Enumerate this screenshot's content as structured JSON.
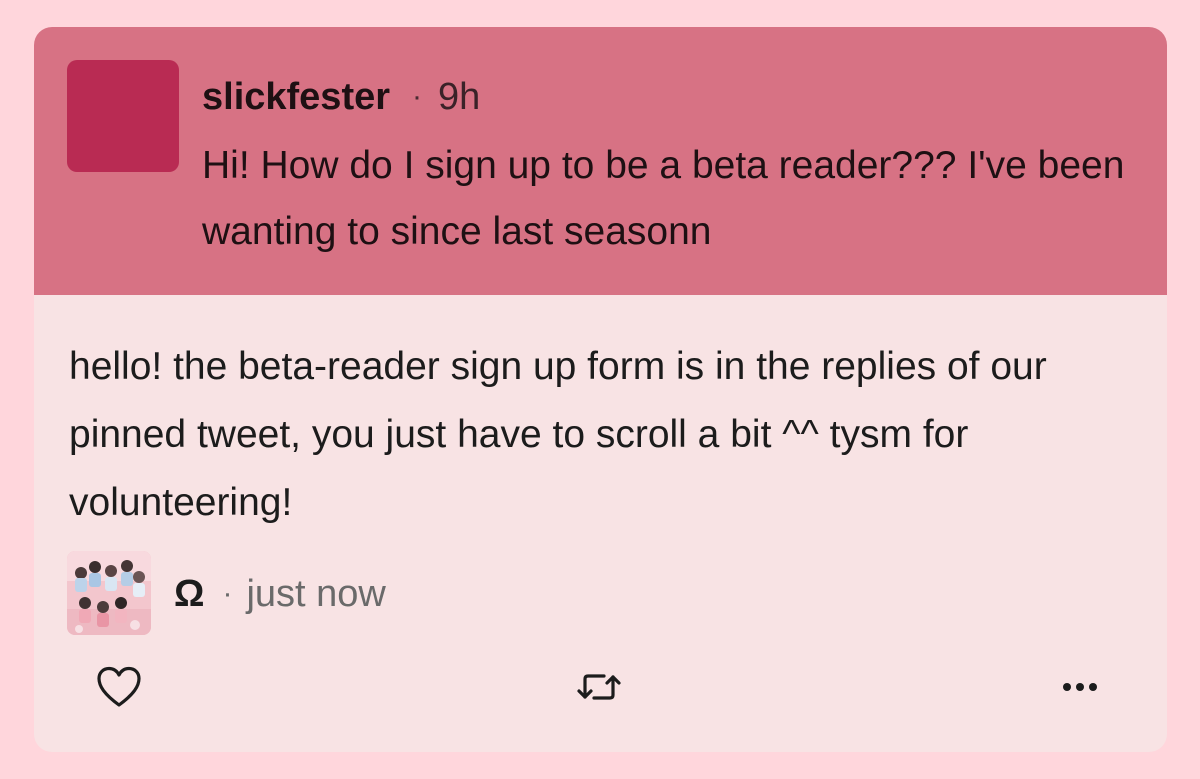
{
  "question": {
    "username": "slickfester",
    "separator": "·",
    "timestamp": "9h",
    "text": "Hi! How do I sign up to be a beta reader??? I've been wanting to since last seasonn",
    "avatar_color": "#b92b53",
    "background_color": "#d77284"
  },
  "answer": {
    "text": "hello! the beta-reader sign up form is in the replies of our pinned tweet, you just have to scroll a bit ^^ tysm for volunteering!",
    "username": "Ω",
    "separator": "·",
    "timestamp": "just now",
    "avatar_icon": "group-photo-avatar",
    "background_color": "#f8e3e4"
  },
  "actions": {
    "like_icon": "heart-icon",
    "repost_icon": "repost-icon",
    "more_icon": "more-options-icon"
  },
  "page_background": "#ffd6dc"
}
